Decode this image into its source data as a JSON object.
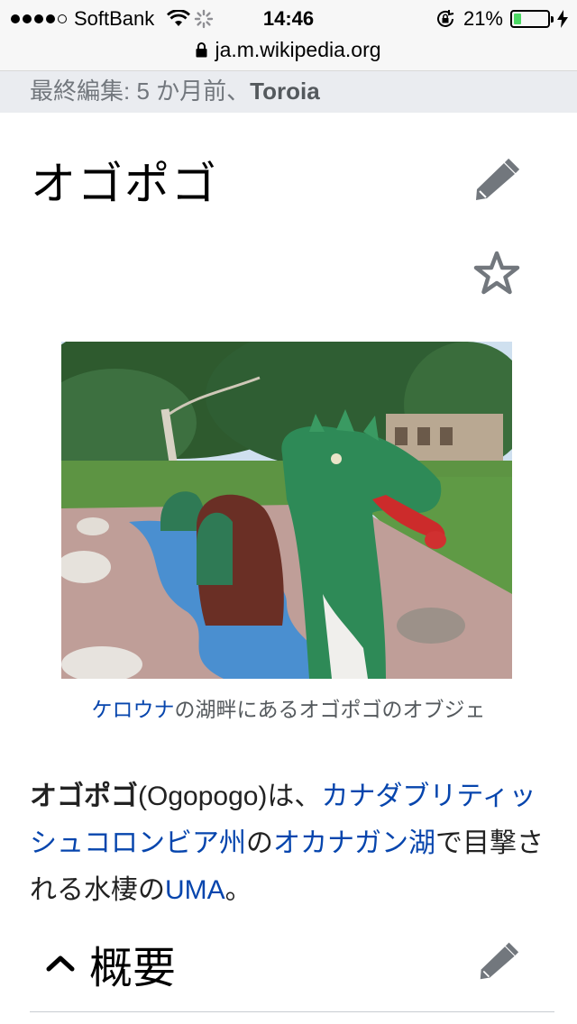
{
  "status_bar": {
    "carrier": "SoftBank",
    "time": "14:46",
    "battery_percent": "21%",
    "battery_level": 0.21,
    "signal_bars_filled": 4,
    "signal_bars_total": 5
  },
  "browser": {
    "url": "ja.m.wikipedia.org"
  },
  "last_edit": {
    "prefix": "最終編集: 5 か月前、",
    "editor": "Toroia"
  },
  "article": {
    "title": "オゴポゴ",
    "figure_caption_link": "ケロウナ",
    "figure_caption_rest": "の湖畔にあるオゴポゴのオブジェ",
    "lead": {
      "bold_term": "オゴポゴ",
      "t1": "(Ogopogo)は、",
      "link1": "カナダブリティッシュコロンビア州",
      "t2": "の",
      "link2": "オカナガン湖",
      "t3": "で目撃される水棲の",
      "link3": "UMA",
      "t4": "。"
    },
    "section": {
      "title": "概要"
    }
  },
  "colors": {
    "link": "#0645ad",
    "text": "#222222",
    "icon_gray": "#72777d",
    "edit_bar_bg": "#eaecf0",
    "battery_green": "#4cd964"
  },
  "icons": {
    "edit": "pencil-icon",
    "watch": "star-icon",
    "collapse": "chevron-up-icon",
    "secure": "lock-icon"
  }
}
